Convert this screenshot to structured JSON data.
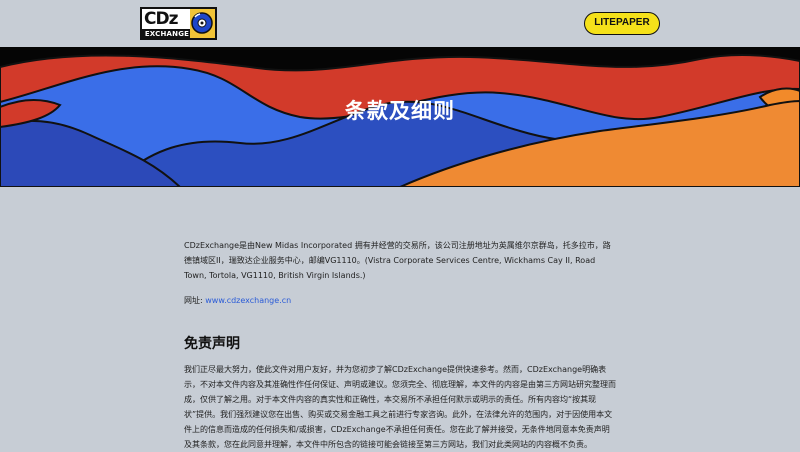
{
  "header": {
    "logo_text": "CDz",
    "logo_sub": "EXCHANGE",
    "litepaper_label": "LITEPAPER"
  },
  "hero": {
    "title": "条款及细则"
  },
  "intro": {
    "paragraph": "CDzExchange是由New Midas Incorporated 拥有并经营的交易所，该公司注册地址为英属维尔京群岛，托多拉市，路德镇域区II，瑞致达企业服务中心，邮编VG1110。(Vistra Corporate Services Centre, Wickhams Cay II, Road Town, Tortola, VG1110, British Virgin Islands.)",
    "website_label": "网址: ",
    "website_link": "www.cdzexchange.cn"
  },
  "disclaimer": {
    "title": "免责声明",
    "body": "我们正尽最大努力，使此文件对用户友好，并为您初步了解CDzExchange提供快速参考。然而，CDzExchange明确表示，不对本文件内容及其准确性作任何保证、声明或建议。您须完全、彻底理解，本文件的内容是由第三方网站研究整理而成，仅供了解之用。对于本文件内容的真实性和正确性，本交易所不承担任何默示或明示的责任。所有内容均“按其现状”提供。我们强烈建议您在出售、购买或交易金融工具之前进行专家咨询。此外，在法律允许的范围内，对于因使用本文件上的信息而造成的任何损失和/或损害，CDzExchange不承担任何责任。您在此了解并接受，无条件地同意本免责声明及其条款，您在此同意并理解，本文件中所包含的链接可能会链接至第三方网站，我们对此类网站的内容概不负责。"
  }
}
